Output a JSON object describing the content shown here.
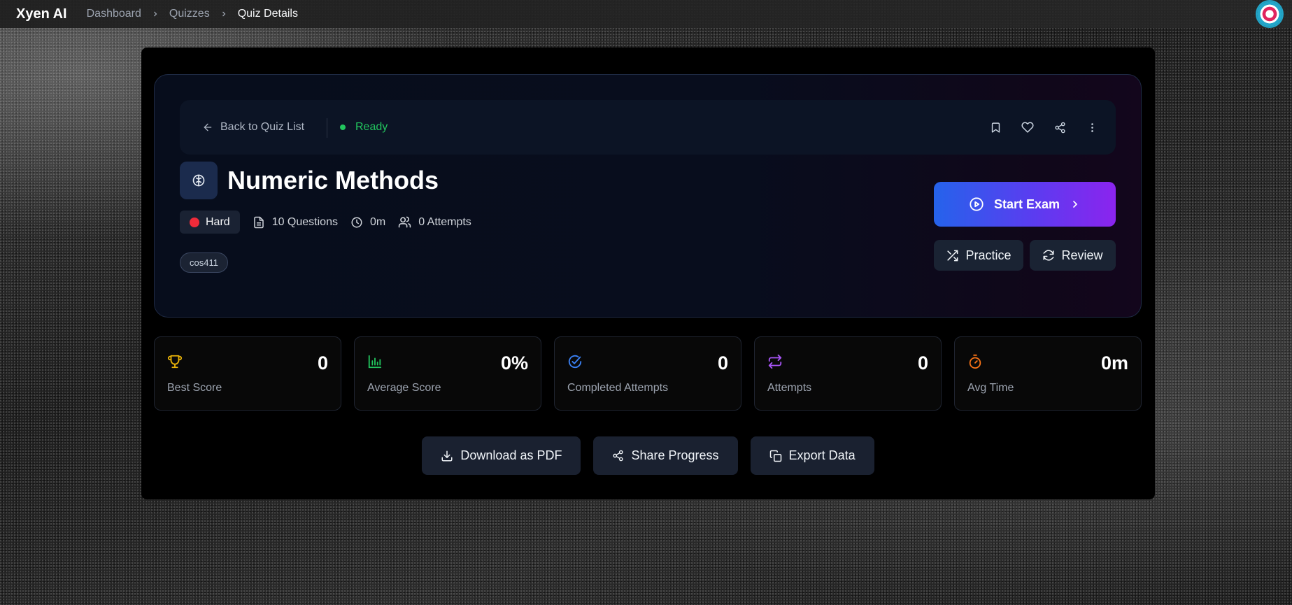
{
  "app": {
    "brand": "Xyen AI"
  },
  "breadcrumbs": [
    "Dashboard",
    "Quizzes",
    "Quiz Details"
  ],
  "header_bar": {
    "back_label": "Back to Quiz List",
    "status": "Ready",
    "status_color": "#22c55e",
    "icons": [
      "bookmark-icon",
      "heart-icon",
      "share-icon",
      "more-vertical-icon"
    ]
  },
  "quiz": {
    "title": "Numeric Methods",
    "difficulty": "Hard",
    "difficulty_color": "#ef2b3a",
    "questions": "10 Questions",
    "duration": "0m",
    "attempts": "0 Attempts",
    "tag": "cos411"
  },
  "buttons": {
    "start": "Start Exam",
    "practice": "Practice",
    "review": "Review"
  },
  "stats": [
    {
      "label": "Best Score",
      "value": "0",
      "icon": "trophy-icon",
      "color": "#eab308"
    },
    {
      "label": "Average Score",
      "value": "0%",
      "icon": "bar-chart-icon",
      "color": "#22c55e"
    },
    {
      "label": "Completed Attempts",
      "value": "0",
      "icon": "check-circle-icon",
      "color": "#3b82f6"
    },
    {
      "label": "Attempts",
      "value": "0",
      "icon": "repeat-icon",
      "color": "#a855f7"
    },
    {
      "label": "Avg Time",
      "value": "0m",
      "icon": "timer-icon",
      "color": "#f97316"
    }
  ],
  "actions": {
    "download": "Download as PDF",
    "share": "Share Progress",
    "export": "Export Data"
  },
  "colors": {
    "start_gradient_from": "#2563eb",
    "start_gradient_to": "#8b24ee"
  }
}
